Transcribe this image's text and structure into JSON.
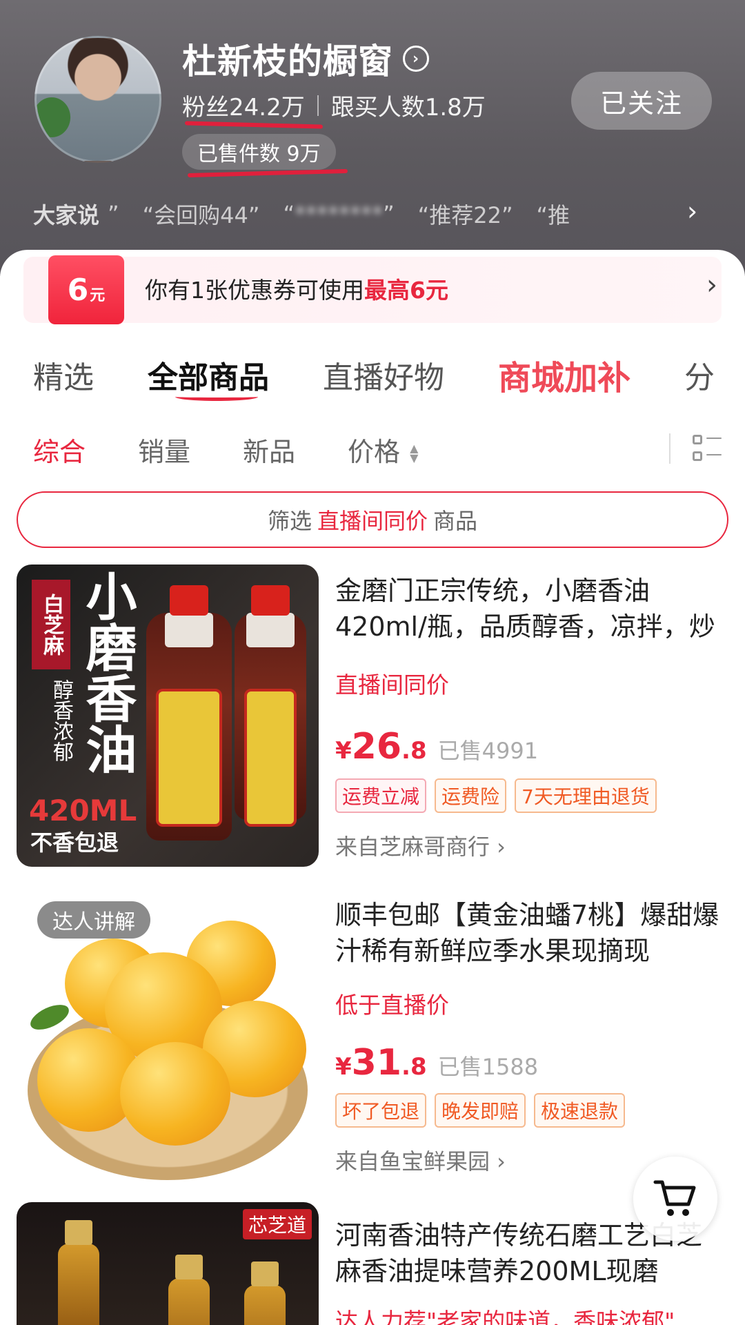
{
  "header": {
    "shop_name": "杜新枝的橱窗",
    "title_arrow": "›",
    "fans": "粉丝24.2万",
    "followers_buy": "跟买人数1.8万",
    "sold_count": "已售件数 9万",
    "follow_label": "已关注",
    "reviews_lead": "大家说",
    "reviews": [
      "”",
      "“会回购44”",
      "“",
      "********",
      "”",
      "“推荐22”",
      "“推"
    ],
    "reviews_chevron": "›"
  },
  "coupon": {
    "badge_amount": "6",
    "badge_unit": "元",
    "text_prefix": "你有1张优惠券可使用",
    "text_highlight": "最高6元",
    "chevron": "›"
  },
  "tabs": [
    "精选",
    "全部商品",
    "直播好物",
    "商城加补",
    "分"
  ],
  "sorts": [
    "综合",
    "销量",
    "新品",
    "价格"
  ],
  "filter": {
    "prefix": "筛选",
    "highlight": "直播间同价",
    "suffix": "商品"
  },
  "products": [
    {
      "title": "金磨门正宗传统，小磨香油420ml/瓶，品质醇香，凉拌，炒",
      "subtitle": "直播间同价",
      "price_currency": "¥",
      "price_int": "26",
      "price_dec": ".8",
      "sold": "已售4991",
      "tags": [
        "运费立减",
        "运费险",
        "7天无理由退货"
      ],
      "store": "来自芝麻哥商行 ›",
      "image": {
        "side_label": "白芝麻",
        "big_text": "小磨香油",
        "side_text": "醇香浓郁",
        "volume": "420ML",
        "bottom": "不香包退"
      }
    },
    {
      "title": "顺丰包邮【黄金油蟠7桃】爆甜爆汁稀有新鲜应季水果现摘现",
      "subtitle": "低于直播价",
      "price_currency": "¥",
      "price_int": "31",
      "price_dec": ".8",
      "sold": "已售1588",
      "tags": [
        "坏了包退",
        "晚发即赔",
        "极速退款"
      ],
      "store": "来自鱼宝鲜果园 ›",
      "image": {
        "badge": "达人讲解"
      }
    },
    {
      "title": "河南香油特产传统石磨工艺白芝麻香油提味营养200ML现磨",
      "subtitle": "达人力荐\"老家的味道，香味浓郁\"",
      "image": {
        "brand": "芯芝道"
      }
    }
  ],
  "colors": {
    "accent_red": "#e8273f",
    "header_gray": "#5d5a5f",
    "tag_orange": "#f05a24"
  },
  "icons": {
    "title_arrow": "circle-chevron-icon",
    "view_toggle": "grid-list-icon",
    "cart": "shopping-cart-icon"
  }
}
